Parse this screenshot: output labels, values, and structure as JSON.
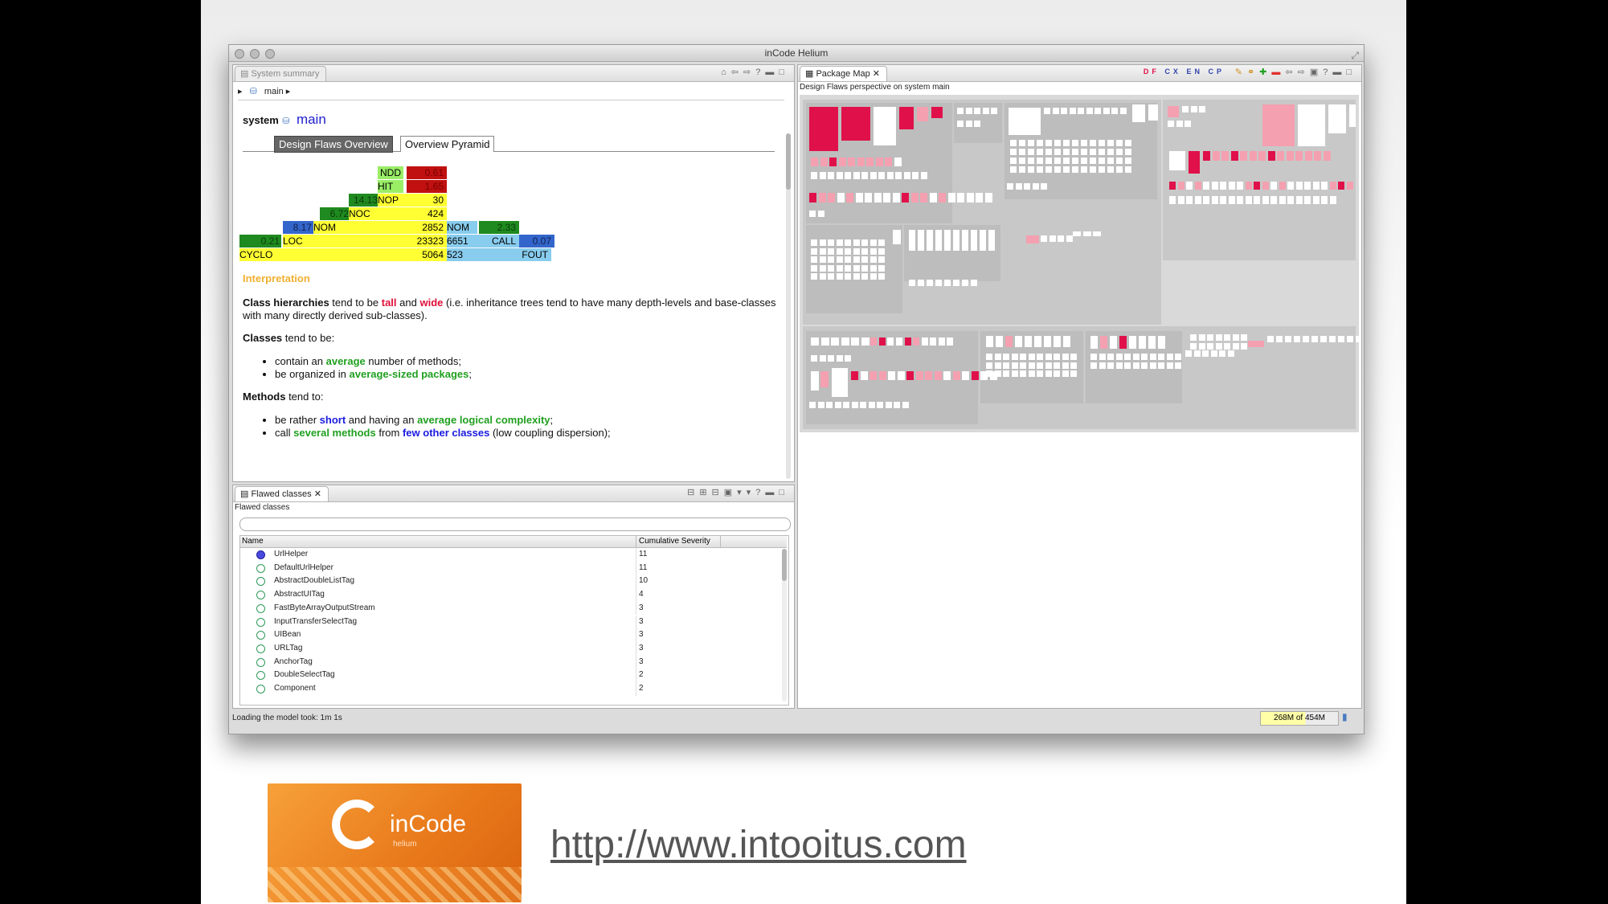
{
  "window": {
    "title": "inCode Helium",
    "status": "Loading the model took: 1m 1s",
    "memory": "268M of 454M"
  },
  "summary_panel": {
    "tab_label": "System summary",
    "breadcrumb": "main",
    "system_label": "system",
    "system_name": "main",
    "subtabs": [
      "Design Flaws Overview",
      "Overview Pyramid"
    ],
    "pyramid": {
      "ndd": {
        "label": "NDD",
        "value": "0.61"
      },
      "hit": {
        "label": "HIT",
        "value": "1.65"
      },
      "nop": {
        "label": "NOP",
        "ratio": "14.13",
        "value": "30"
      },
      "noc": {
        "label": "NOC",
        "ratio": "6.72",
        "value": "424"
      },
      "nom": {
        "label": "NOM",
        "ratio": "8.17",
        "value": "2852"
      },
      "loc": {
        "label": "LOC",
        "ratio": "0.21",
        "value": "23323"
      },
      "cyclo": {
        "label": "CYCLO",
        "value": "5064"
      },
      "nom_right": {
        "label": "NOM",
        "ratio": "2.33"
      },
      "call": {
        "label": "CALL",
        "value": "6651",
        "ratio": "0.07"
      },
      "fout": {
        "label": "FOUT",
        "value": "523"
      }
    },
    "interpretation_title": "Interpretation",
    "hierarchies": {
      "lead": "Class hierarchies",
      "mid": " tend to be ",
      "tall": "tall",
      "and": " and ",
      "wide": "wide",
      "rest": " (i.e. inheritance trees tend to have many depth-levels and base-classes with many directly derived sub-classes)."
    },
    "classes": {
      "lead": "Classes",
      "rest": " tend to be:",
      "b1a": "contain an ",
      "b1b": "average",
      "b1c": " number of methods;",
      "b2a": "be organized in ",
      "b2b": "average-sized packages",
      "b2c": ";"
    },
    "methods": {
      "lead": "Methods",
      "rest": " tend to:",
      "b1a": "be rather ",
      "b1b": "short",
      "b1c": " and having an ",
      "b1d": "average logical complexity",
      "b1e": ";",
      "b2a": "call ",
      "b2b": "several methods",
      "b2c": "  from ",
      "b2d": "few other classes",
      "b2e": " (low coupling dispersion);"
    }
  },
  "flawed_panel": {
    "tab_label": "Flawed classes",
    "subtitle": "Flawed classes",
    "filter_value": "",
    "col_name": "Name",
    "col_severity": "Cumulative Severity",
    "rows": [
      {
        "name": "UrlHelper",
        "severity": "11",
        "icon": "info"
      },
      {
        "name": "DefaultUrlHelper",
        "severity": "11",
        "icon": "class"
      },
      {
        "name": "AbstractDoubleListTag",
        "severity": "10",
        "icon": "abstract-class"
      },
      {
        "name": "AbstractUITag",
        "severity": "4",
        "icon": "abstract-class"
      },
      {
        "name": "FastByteArrayOutputStream",
        "severity": "3",
        "icon": "class"
      },
      {
        "name": "InputTransferSelectTag",
        "severity": "3",
        "icon": "class"
      },
      {
        "name": "UIBean",
        "severity": "3",
        "icon": "abstract-class"
      },
      {
        "name": "URLTag",
        "severity": "3",
        "icon": "class"
      },
      {
        "name": "AnchorTag",
        "severity": "3",
        "icon": "class"
      },
      {
        "name": "DoubleSelectTag",
        "severity": "2",
        "icon": "class"
      },
      {
        "name": "Component",
        "severity": "2",
        "icon": "class"
      }
    ]
  },
  "package_map": {
    "tab_label": "Package Map",
    "subtitle": "Design Flaws perspective on system main",
    "toolbar_codes": [
      "DF",
      "CX",
      "EN",
      "CP"
    ]
  },
  "footer": {
    "logo_text": "inCode",
    "logo_sub": "helium",
    "url": "http://www.intooitus.com"
  },
  "colors": {
    "flaw_red": "#e0114a",
    "flaw_pink": "#f4a0b0",
    "pyramid_yellow": "#ffff33"
  }
}
